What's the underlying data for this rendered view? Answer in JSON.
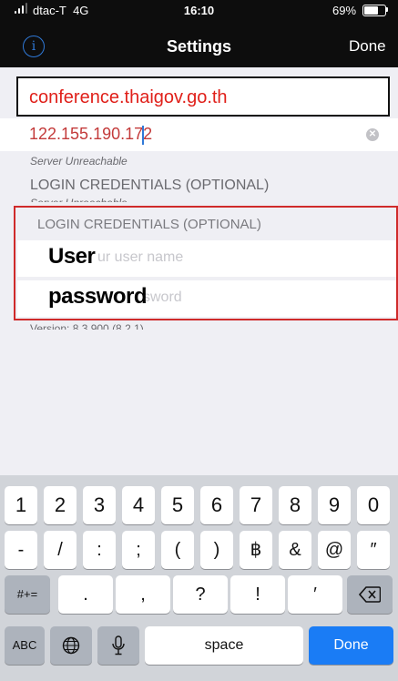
{
  "status_bar": {
    "carrier": "dtac-T",
    "network": "4G",
    "time": "16:10",
    "battery": "69%",
    "battery_level": 0.69
  },
  "nav": {
    "title": "Settings",
    "done": "Done",
    "info_glyph": "i"
  },
  "form": {
    "highlight_text": "conference.thaigov.go.th",
    "server_value": "122.155.190.172",
    "server_status": "Server Unreachable",
    "login_header": "LOGIN CREDENTIALS (OPTIONAL)",
    "username_placeholder": "Enter your user name",
    "username_visible": "ur user name",
    "username_overlay": "User",
    "password_visible": "sword",
    "password_overlay": "password",
    "version": "Version: 8.3.900 (8.2.1)"
  },
  "keyboard": {
    "row1": [
      "1",
      "2",
      "3",
      "4",
      "5",
      "6",
      "7",
      "8",
      "9",
      "0"
    ],
    "row2": [
      "-",
      "/",
      ":",
      ";",
      "(",
      ")",
      "฿",
      "&",
      "@",
      "″"
    ],
    "row3_mode": "#+=",
    "row3": [
      ".",
      ",",
      "?",
      "!",
      "′"
    ],
    "backspace_icon": "backspace-icon",
    "abc": "ABC",
    "globe_icon": "globe-icon",
    "mic_icon": "microphone-icon",
    "space": "space",
    "done": "Done",
    "done_color": "#1a7cf5"
  },
  "colors": {
    "accent": "#2f79d8",
    "highlight_red": "#cf2a2a"
  }
}
